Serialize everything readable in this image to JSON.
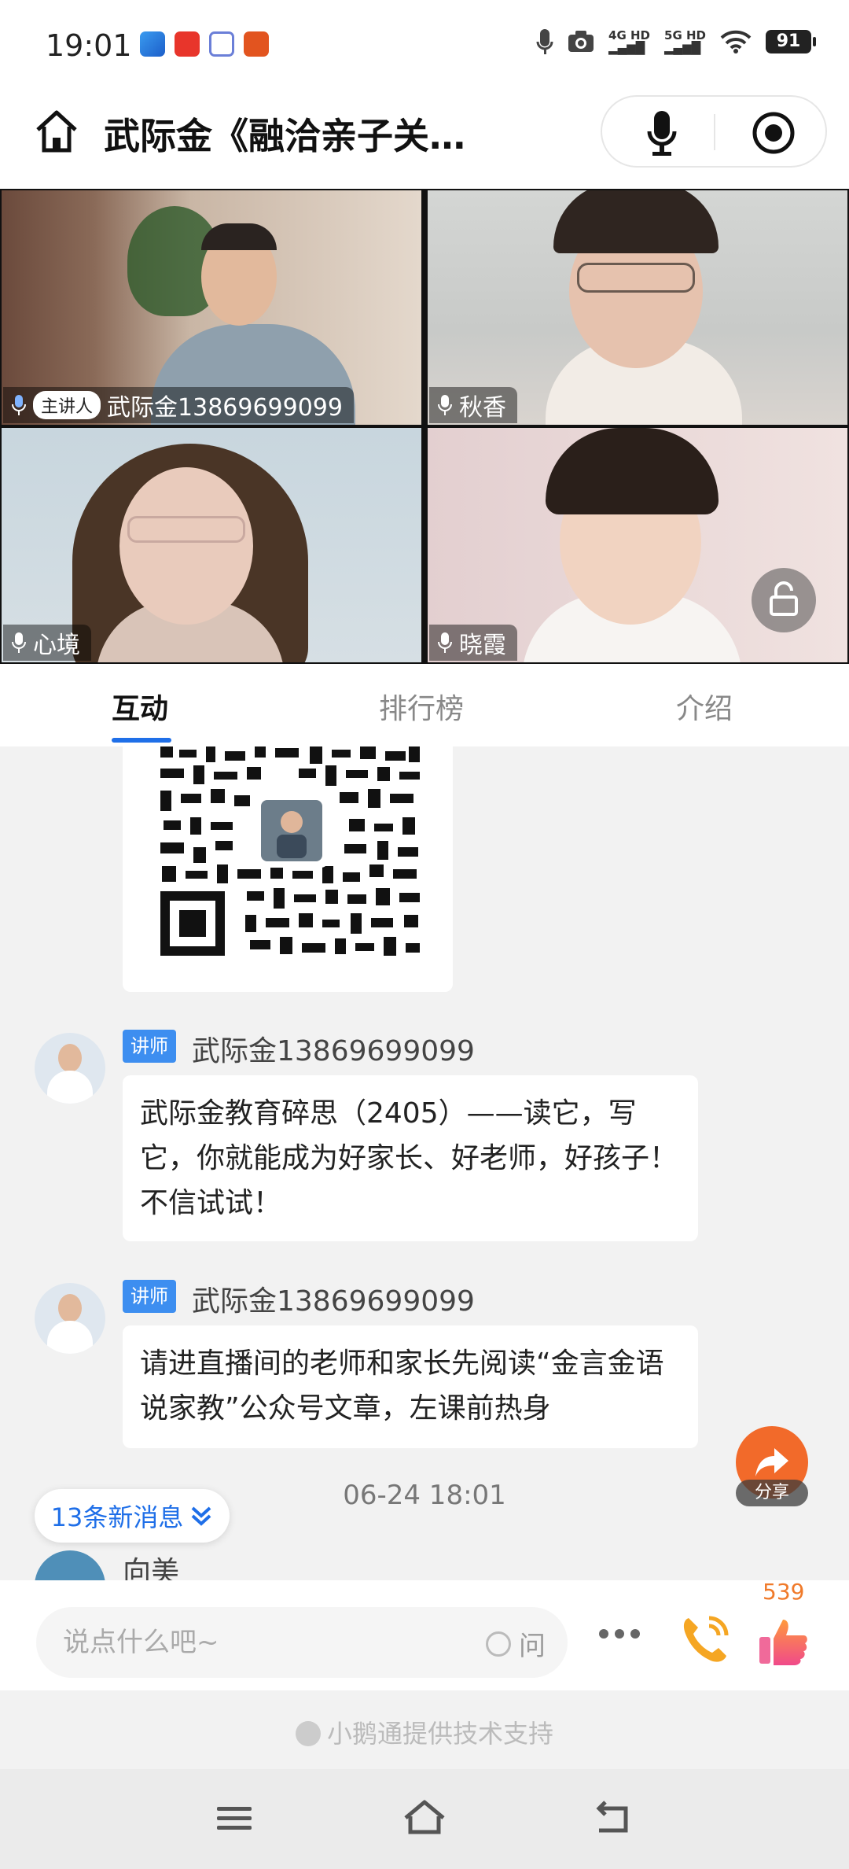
{
  "status_bar": {
    "time": "19:01",
    "net_4g": "4G HD",
    "net_5g": "5G HD",
    "battery": "91"
  },
  "header": {
    "title": "武际金《融洽亲子关…"
  },
  "participants": [
    {
      "name": "武际金13869699099",
      "role": "主讲人"
    },
    {
      "name": "秋香"
    },
    {
      "name": "心境"
    },
    {
      "name": "晓霞"
    }
  ],
  "tabs": [
    {
      "label": "互动"
    },
    {
      "label": "排行榜"
    },
    {
      "label": "介绍"
    }
  ],
  "messages": [
    {
      "role": "讲师",
      "sender": "武际金13869699099",
      "text": "武际金教育碎思（2405）——读它，写它，你就能成为好家长、好老师，好孩子！不信试试！"
    },
    {
      "role": "讲师",
      "sender": "武际金13869699099",
      "text": "请进直播间的老师和家长先阅读“金言金语说家教”公众号文章，左课前热身"
    }
  ],
  "time_separator": "06-24 18:01",
  "new_messages": "13条新消息",
  "partial_sender": "向美",
  "share_label": "分享",
  "input": {
    "placeholder": "说点什么吧~",
    "ask_label": "问"
  },
  "like_count": "539",
  "footer": {
    "powered_by": "小鹅通提供技术支持"
  },
  "colors": {
    "accent": "#1f6fe8",
    "share": "#f26a2a",
    "like": "#f07a2a"
  }
}
